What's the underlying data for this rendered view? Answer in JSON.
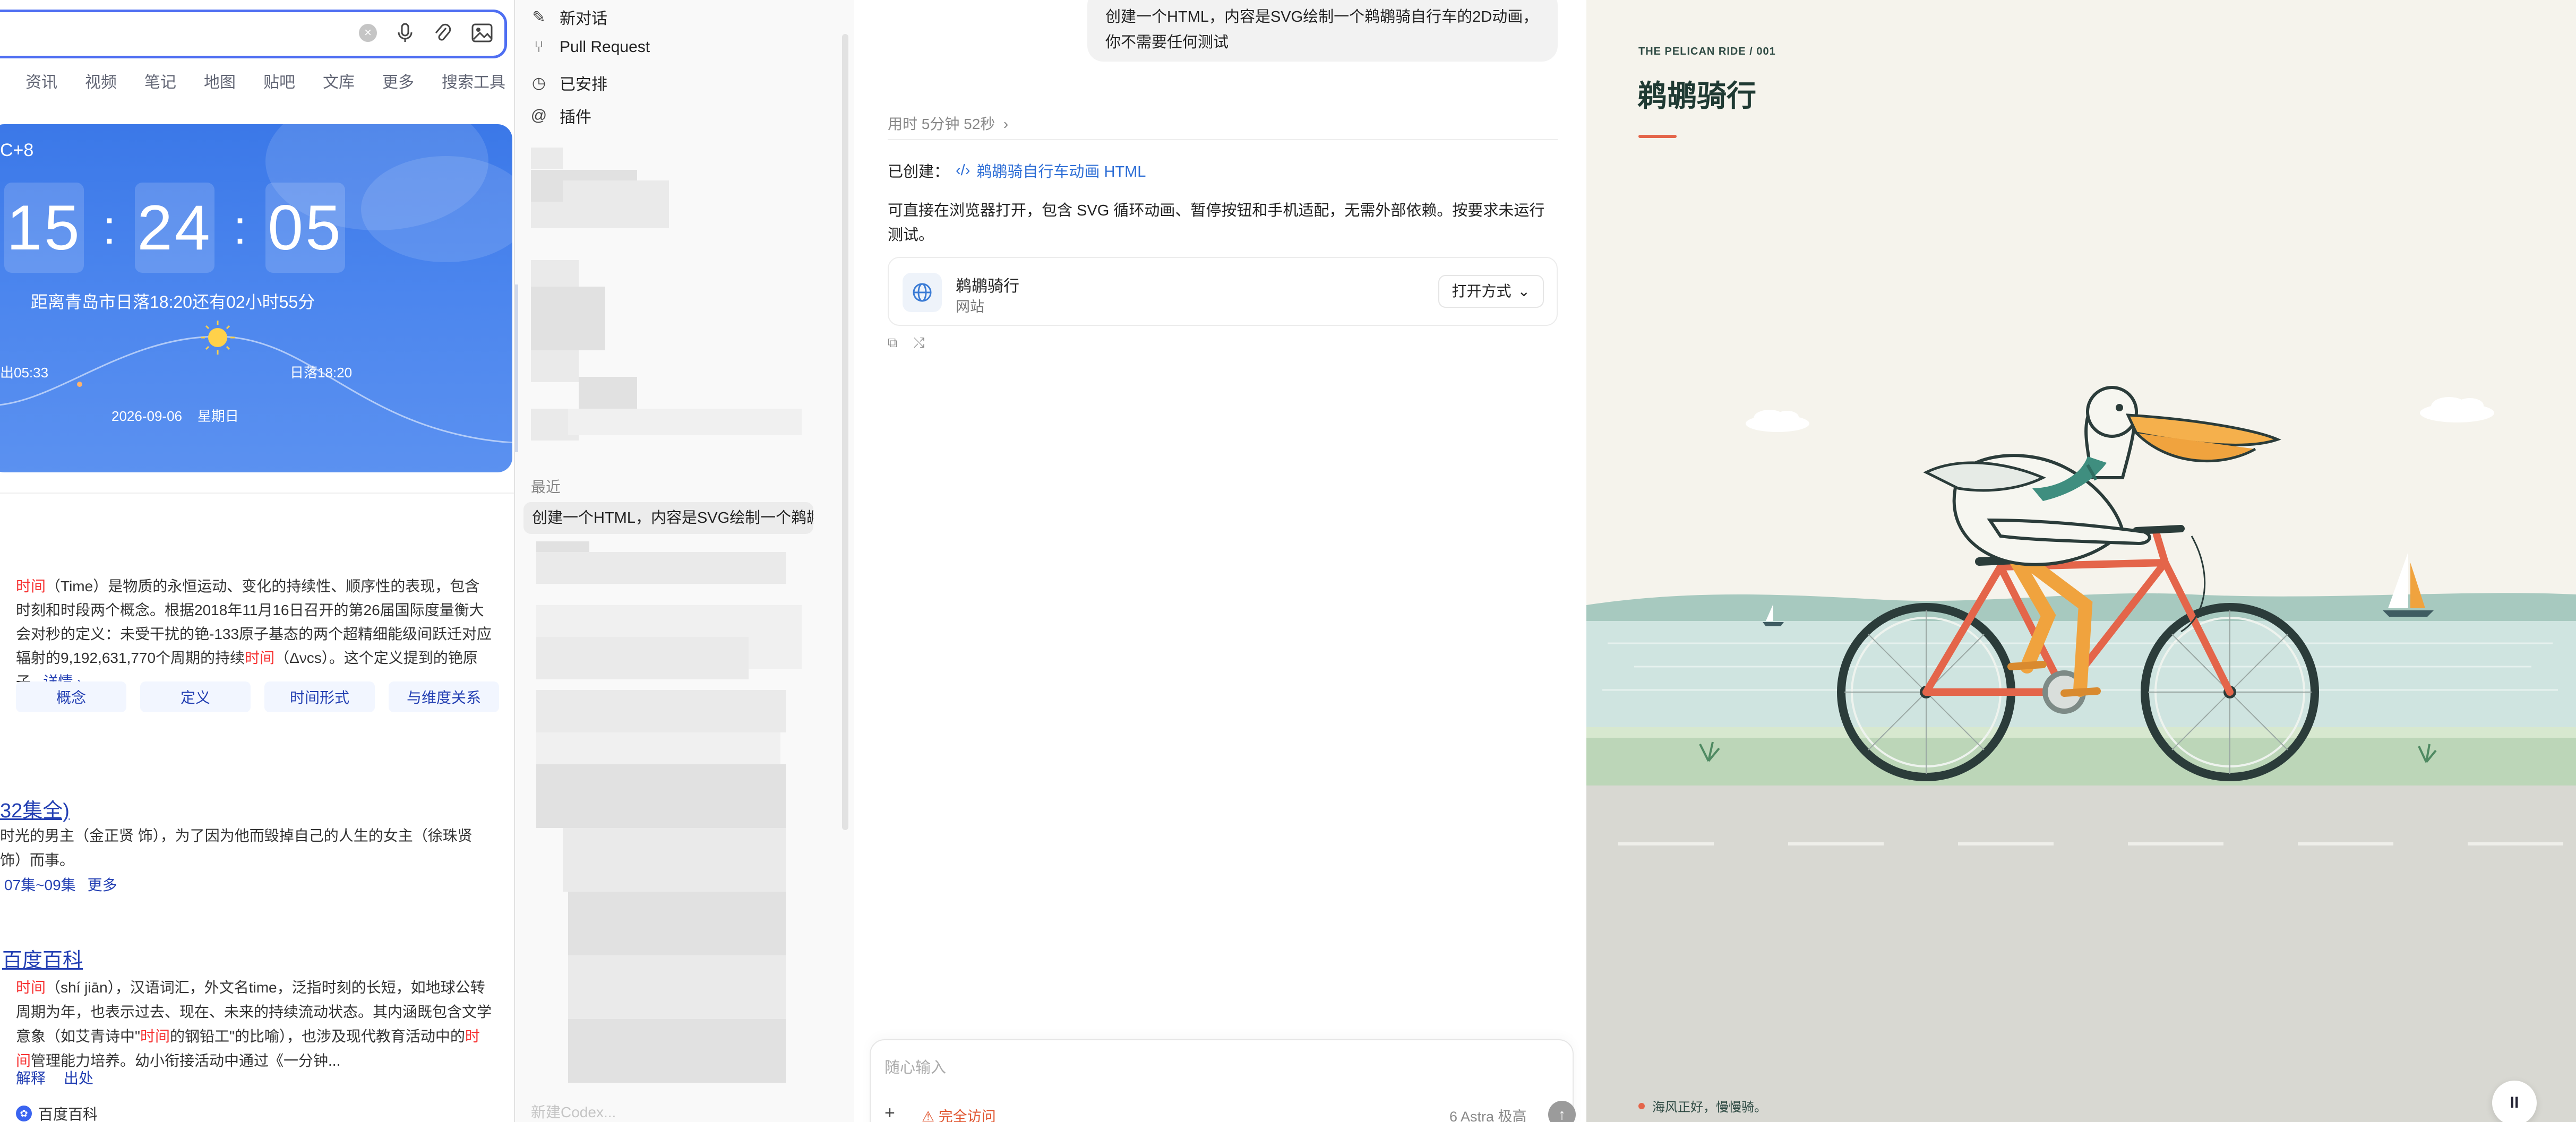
{
  "search_page": {
    "tabs": [
      "资讯",
      "视频",
      "笔记",
      "地图",
      "贴吧",
      "文库",
      "更多",
      "搜索工具"
    ],
    "clock": {
      "timezone": "C+8",
      "hours": "15",
      "minutes": "24",
      "seconds": "05",
      "sunset_note": "距离青岛市日落18:20还有02小时55分",
      "sunrise": "出05:33",
      "sunset": "日落18:20",
      "date": "2026-09-06",
      "weekday": "星期日"
    },
    "definition": {
      "kw1": "时间",
      "part1": "（Time）是物质的永恒运动、变化的持续性、顺序性的表现，包含时刻和时段两个概念。根据2018年11月16日召开的第26届国际度量衡大会对秒的定义：未受干扰的铯-133原子基态的两个超精细能级间跃迁对应辐射的9,192,631,770个周期的持续",
      "kw2": "时间",
      "part2": "（Δνcs）。这个定义提到的铯原子...",
      "more": "详情 ›",
      "chips": [
        "概念",
        "定义",
        "时间形式",
        "与维度关系"
      ]
    },
    "result2": {
      "title": "32集全)",
      "desc": "时光的男主（金正贤 饰），为了因为他而毁掉自己的人生的女主（徐珠贤 饰）而事。",
      "links": [
        "07集~09集",
        "更多"
      ]
    },
    "result3": {
      "title": "百度百科",
      "kw1": "时间",
      "part1": "（shí jiān），汉语词汇，外文名time，泛指时刻的长短，如地球公转周期为年，也表示过去、现在、未来的持续流动状态。其内涵既包含文学意象（如艾青诗中\"",
      "kw2": "时间",
      "part2": "的钢铅工\"的比喻），也涉及现代教育活动中的",
      "kw3": "时间",
      "part3": "管理能力培养。幼小衔接活动中通过《一分钟...",
      "links": [
        "解释",
        "出处"
      ],
      "source": "百度百科"
    }
  },
  "sidebar": {
    "items": [
      {
        "icon": "new-chat-icon",
        "label": "新对话"
      },
      {
        "icon": "pull-request-icon",
        "label": "Pull Request"
      },
      {
        "icon": "clock-icon",
        "label": "已安排"
      },
      {
        "icon": "at-icon",
        "label": "插件"
      }
    ],
    "recent_heading": "最近",
    "recent_item": "创建一个HTML，内容是SVG绘制一个鹈鹕骑",
    "bottom_text": "新建Codex..."
  },
  "chat": {
    "user_message": "创建一个HTML，内容是SVG绘制一个鹈鹕骑自行车的2D动画，你不需要任何测试",
    "elapsed": "用时 5分钟 52秒",
    "created_label": "已创建：",
    "created_link": "鹈鹕骑自行车动画 HTML",
    "reply": "可直接在浏览器打开，包含 SVG 循环动画、暂停按钮和手机适配，无需外部依赖。按要求未运行测试。",
    "file_card": {
      "title": "鹈鹕骑行",
      "subtitle": "网站",
      "open_label": "打开方式"
    },
    "composer": {
      "placeholder": "随心输入",
      "access": "完全访问",
      "model": "6 Astra 极高"
    }
  },
  "preview": {
    "eyebrow": "THE PELICAN RIDE / 001",
    "title": "鹈鹕骑行",
    "tagline": "海风正好，慢慢骑。",
    "pause_label": "II",
    "colors": {
      "sky": "#f5f3ec",
      "sea": "#cfe4e0",
      "road": "#d8d8d2",
      "frame": "#e4654a",
      "beak": "#f0a33e",
      "scarf": "#3f8e7f"
    }
  }
}
